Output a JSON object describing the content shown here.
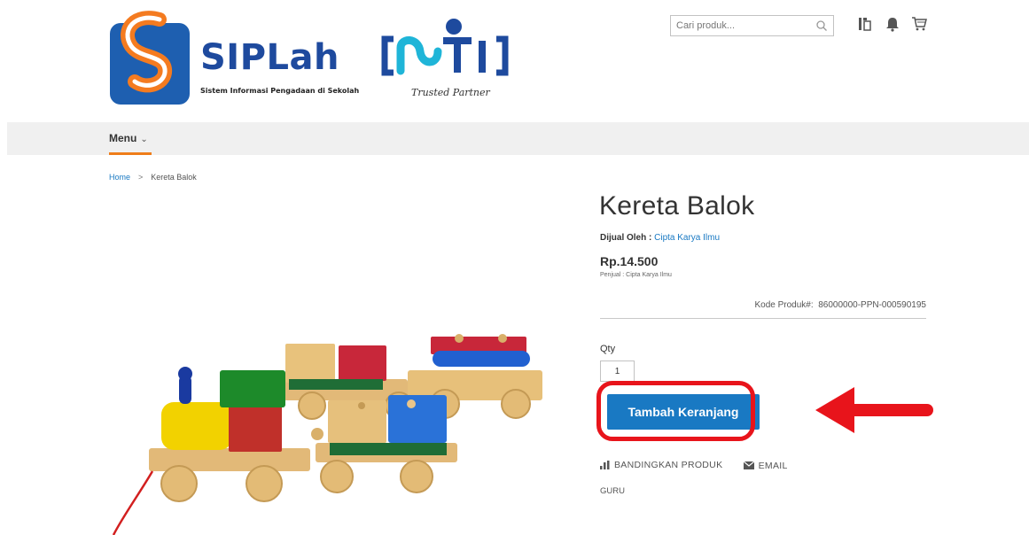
{
  "header": {
    "logo_text": "SIPLah",
    "logo_subtitle": "Sistem Informasi Pengadaan di Sekolah",
    "partner_logo_text": "INITI",
    "partner_tagline": "Trusted Partner",
    "search_placeholder": "Cari produk...",
    "icons": [
      "search-icon",
      "compare-icon",
      "notification-bell-icon",
      "cart-icon"
    ]
  },
  "nav": {
    "menu_label": "Menu"
  },
  "breadcrumb": {
    "home": "Home",
    "current": "Kereta Balok"
  },
  "product": {
    "title": "Kereta Balok",
    "seller_label": "Dijual Oleh :",
    "seller_name": "Cipta Karya Ilmu",
    "price": "Rp.14.500",
    "penjual": "Penjual : Cipta Karya Ilmu",
    "code_label": "Kode Produk#:",
    "code_value": "86000000-PPN-000590195",
    "qty_label": "Qty",
    "qty_value": "1",
    "add_to_cart": "Tambah Keranjang",
    "compare": "BANDINGKAN PRODUK",
    "email": "EMAIL",
    "category": "GURU"
  },
  "colors": {
    "accent_blue": "#1979c3",
    "nav_underline": "#ef7d1a",
    "highlight_red": "#e8141b",
    "logo_blue": "#1e4a9e"
  }
}
